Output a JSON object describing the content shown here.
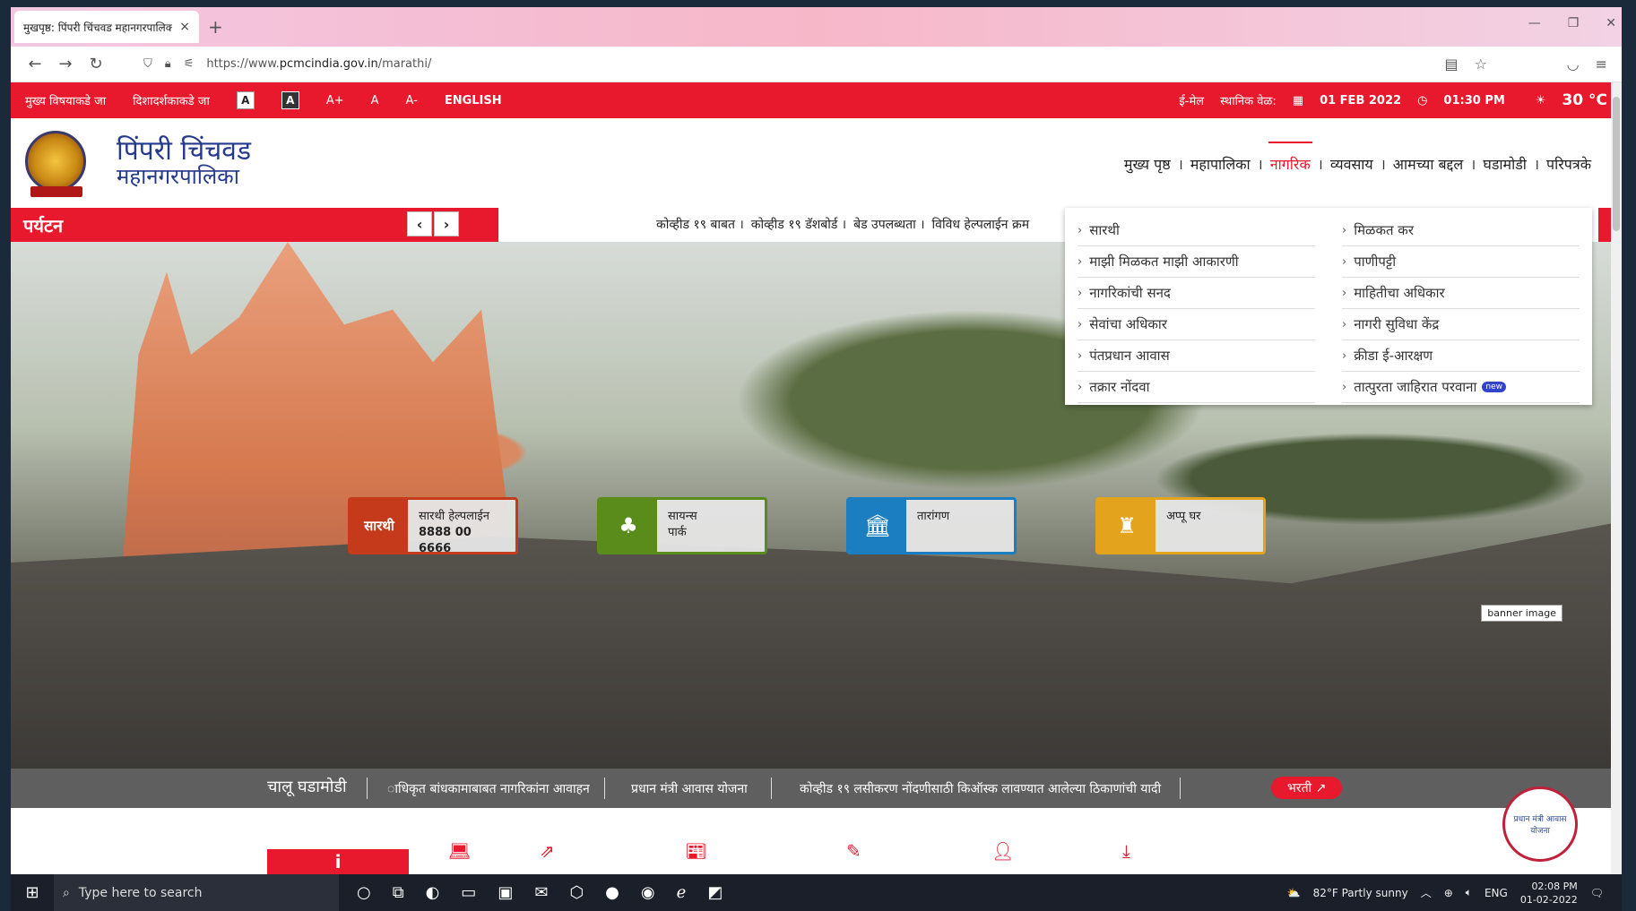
{
  "browser": {
    "tab_title": "मुखपृष्ठ: पिंपरी चिंचवड महानगरपालिका",
    "tab_close": "×",
    "new_tab": "+",
    "url_prefix": "https://www.",
    "url_domain": "pcmcindia.gov.in",
    "url_path": "/marathi/"
  },
  "topbar": {
    "skip_main": "मुख्य विषयाकडे जा",
    "skip_nav": "दिशादर्शकाकडे जा",
    "contrast_light": "A",
    "contrast_dark": "A",
    "font_plus": "A+",
    "font_normal": "A",
    "font_minus": "A-",
    "english": "ENGLISH",
    "email": "ई-मेल",
    "local_time_label": "स्थानिक वेळ:",
    "date": "01 FEB 2022",
    "time": "01:30 PM",
    "temperature": "30 °C"
  },
  "header": {
    "brand_line1": "पिंपरी चिंचवड",
    "brand_line2": "महानगरपालिका",
    "nav": [
      "मुख्य पृष्ठ",
      "महापालिका",
      "नागरिक",
      "व्यवसाय",
      "आमच्या बद्दल",
      "घडामोडी",
      "परिपत्रके"
    ],
    "separator": "।"
  },
  "ticker": {
    "section_label": "पर्यटन",
    "prev": "‹",
    "next": "›",
    "items": [
      "कोव्हीड १९ बाबत ।",
      "कोव्हीड १९ डॅशबोर्ड ।",
      "बेड उपलब्धता ।",
      "विविध हेल्पलाईन क्रम"
    ]
  },
  "dropdown": {
    "left": [
      "सारथी",
      "माझी मिळकत माझी आकारणी",
      "नागरिकांची सनद",
      "सेवांचा अधिकार",
      "पंतप्रधान आवास",
      "तक्रार नोंदवा"
    ],
    "right": [
      "मिळकत कर",
      "पाणीपट्टी",
      "माहितीचा अधिकार",
      "नागरी सुविधा केंद्र",
      "क्रीडा ई-आरक्षण",
      "तात्पुरता जाहिरात परवाना"
    ],
    "new_badge": "new"
  },
  "quicklinks": [
    {
      "icon_text": "सारथी",
      "line1": "सारथी हेल्पलाईन",
      "line2": "8888 00 6666"
    },
    {
      "line1": "सायन्स",
      "line2": "पार्क"
    },
    {
      "line1": "तारांगण",
      "line2": ""
    },
    {
      "line1": "अप्पू घर",
      "line2": ""
    }
  ],
  "banner_tooltip": "banner image",
  "events": {
    "label": "चालू घडामोडी",
    "items": [
      "ाधिकृत बांधकामाबाबत नागरिकांना आवाहन",
      "प्रधान मंत्री आवास योजना",
      "कोव्हीड १९ लसीकरण नोंदणीसाठी किऑस्क लावण्यात आलेल्या ठिकाणांची यादी"
    ],
    "bharti": "भरती"
  },
  "yojana_badge": "प्रधान मंत्री आवास योजना",
  "taskbar": {
    "search_placeholder": "Type here to search",
    "weather": "82°F  Partly sunny",
    "lang": "ENG",
    "time": "02:08 PM",
    "date": "01-02-2022"
  },
  "colors": {
    "brand_red": "#e8192c",
    "brand_blue": "#253a8c",
    "events_gray": "#5f5f5f"
  }
}
